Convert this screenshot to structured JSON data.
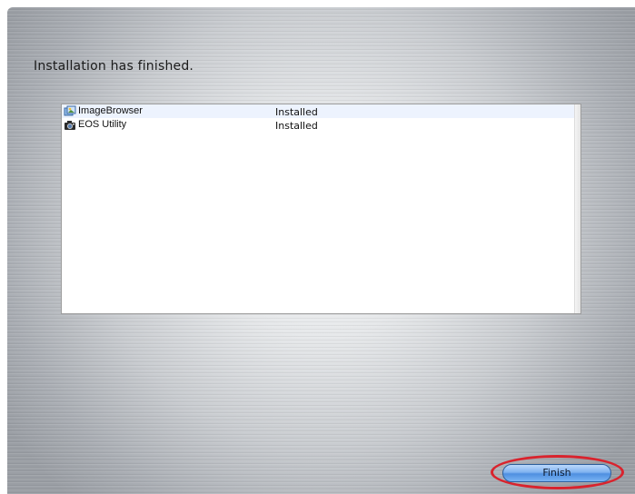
{
  "installer": {
    "title": "Installation has finished.",
    "items": [
      {
        "name": "ImageBrowser",
        "status": "Installed",
        "icon": "imagebrowser-icon"
      },
      {
        "name": "EOS Utility",
        "status": "Installed",
        "icon": "eos-utility-icon"
      }
    ],
    "finish_label": "Finish"
  },
  "colors": {
    "highlight_ring": "#d9232d",
    "button_blue": "#4e8fe0",
    "row_stripe": "#edf3fe"
  }
}
